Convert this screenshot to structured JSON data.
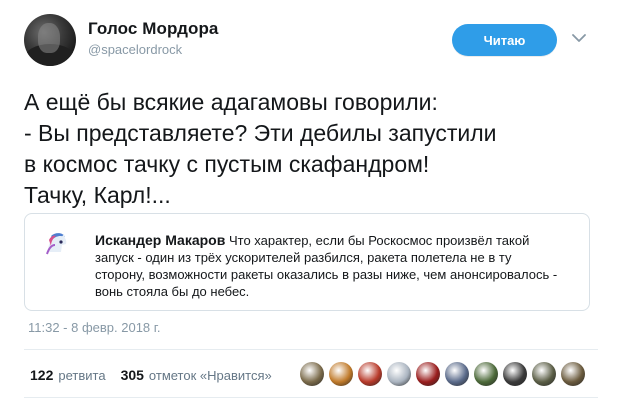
{
  "account": {
    "name": "Голос Мордора",
    "handle": "@spacelordrock"
  },
  "follow_button": {
    "label": "Читаю"
  },
  "tweet": {
    "text": "А ещё бы всякие адагамовы говорили:\n- Вы представляете? Эти дебилы запустили\nв космос тачку с пустым скафандром!\nТачку, Карл!..."
  },
  "quoted_tweet": {
    "author": "Искандер Макаров",
    "text": "Что характер, если бы Роскосмос произвёл такой запуск - один из трёх ускорителей разбился, ракета полетела не в ту сторону, возможности ракеты оказались в разы ниже, чем анонсировалось - вонь стояла бы до небес."
  },
  "timestamp": "11:32 - 8 февр. 2018 г.",
  "stats": {
    "retweets_count": "122",
    "retweets_label": "ретвита",
    "likes_count": "305",
    "likes_label": "отметок «Нравится»"
  },
  "icons": {
    "caret": "chevron-down-icon",
    "quote_avatar": "pony-avatar-icon"
  },
  "colors": {
    "accent": "#2f9de8",
    "muted": "#8899a6",
    "text": "#14171a",
    "border": "#d8e0e6"
  },
  "likers": [
    {
      "color": "#7a6a4a"
    },
    {
      "color": "#c07a2a"
    },
    {
      "color": "#b83a2a"
    },
    {
      "color": "#aab4c0"
    },
    {
      "color": "#9a1e1e"
    },
    {
      "color": "#5a6a8a"
    },
    {
      "color": "#4d6a3a"
    },
    {
      "color": "#3a3a3a"
    },
    {
      "color": "#5b5e46"
    },
    {
      "color": "#6b5b3e"
    }
  ]
}
